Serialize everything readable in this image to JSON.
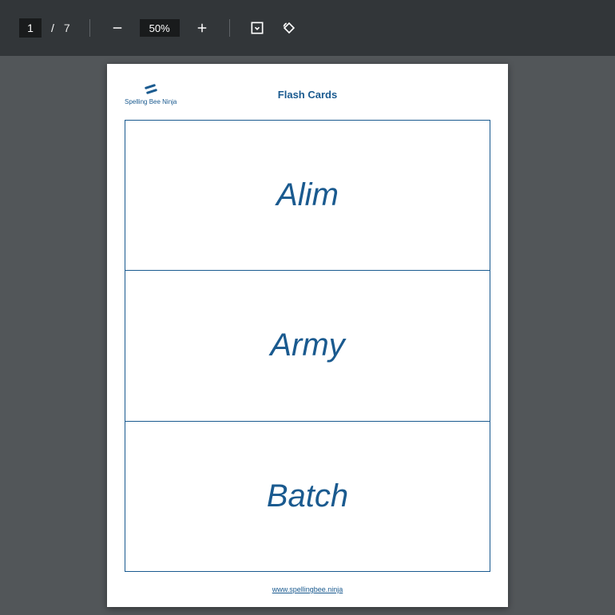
{
  "toolbar": {
    "current_page": "1",
    "page_separator": "/",
    "total_pages": "7",
    "zoom_level": "50%"
  },
  "document": {
    "brand": "Spelling Bee Ninja",
    "title": "Flash Cards",
    "cards": [
      {
        "word": "Alim"
      },
      {
        "word": "Army"
      },
      {
        "word": "Batch"
      }
    ],
    "footer_url": "www.spellingbee.ninja"
  }
}
